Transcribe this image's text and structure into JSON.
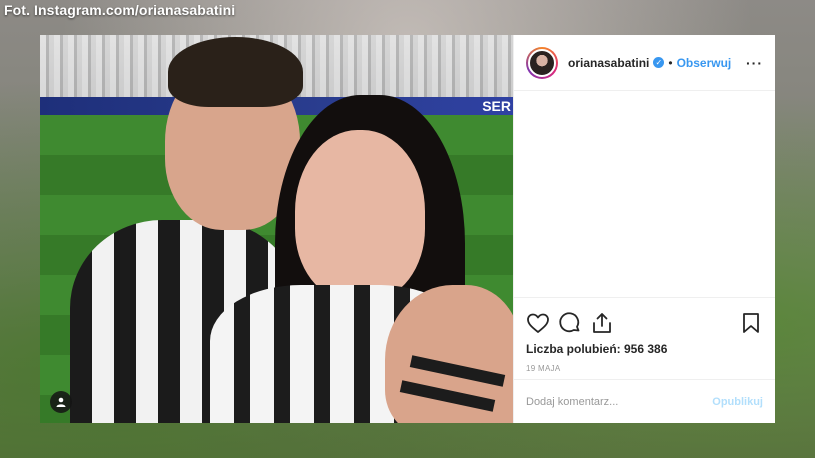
{
  "credit": "Fot. Instagram.com/orianasabatini",
  "post": {
    "username": "orianasabatini",
    "verified_icon": "verified-badge-icon",
    "separator": "•",
    "follow_label": "Obserwuj",
    "more_label": "···",
    "photo_banner_text": "SER",
    "likes_text": "Liczba polubień: 956 386",
    "date": "19 MAJA",
    "comment_placeholder": "Dodaj komentarz...",
    "publish_label": "Opublikuj",
    "colors": {
      "accent": "#3897f0",
      "publish_disabled": "#b2dffc",
      "text": "#262626",
      "muted": "#999999"
    }
  }
}
